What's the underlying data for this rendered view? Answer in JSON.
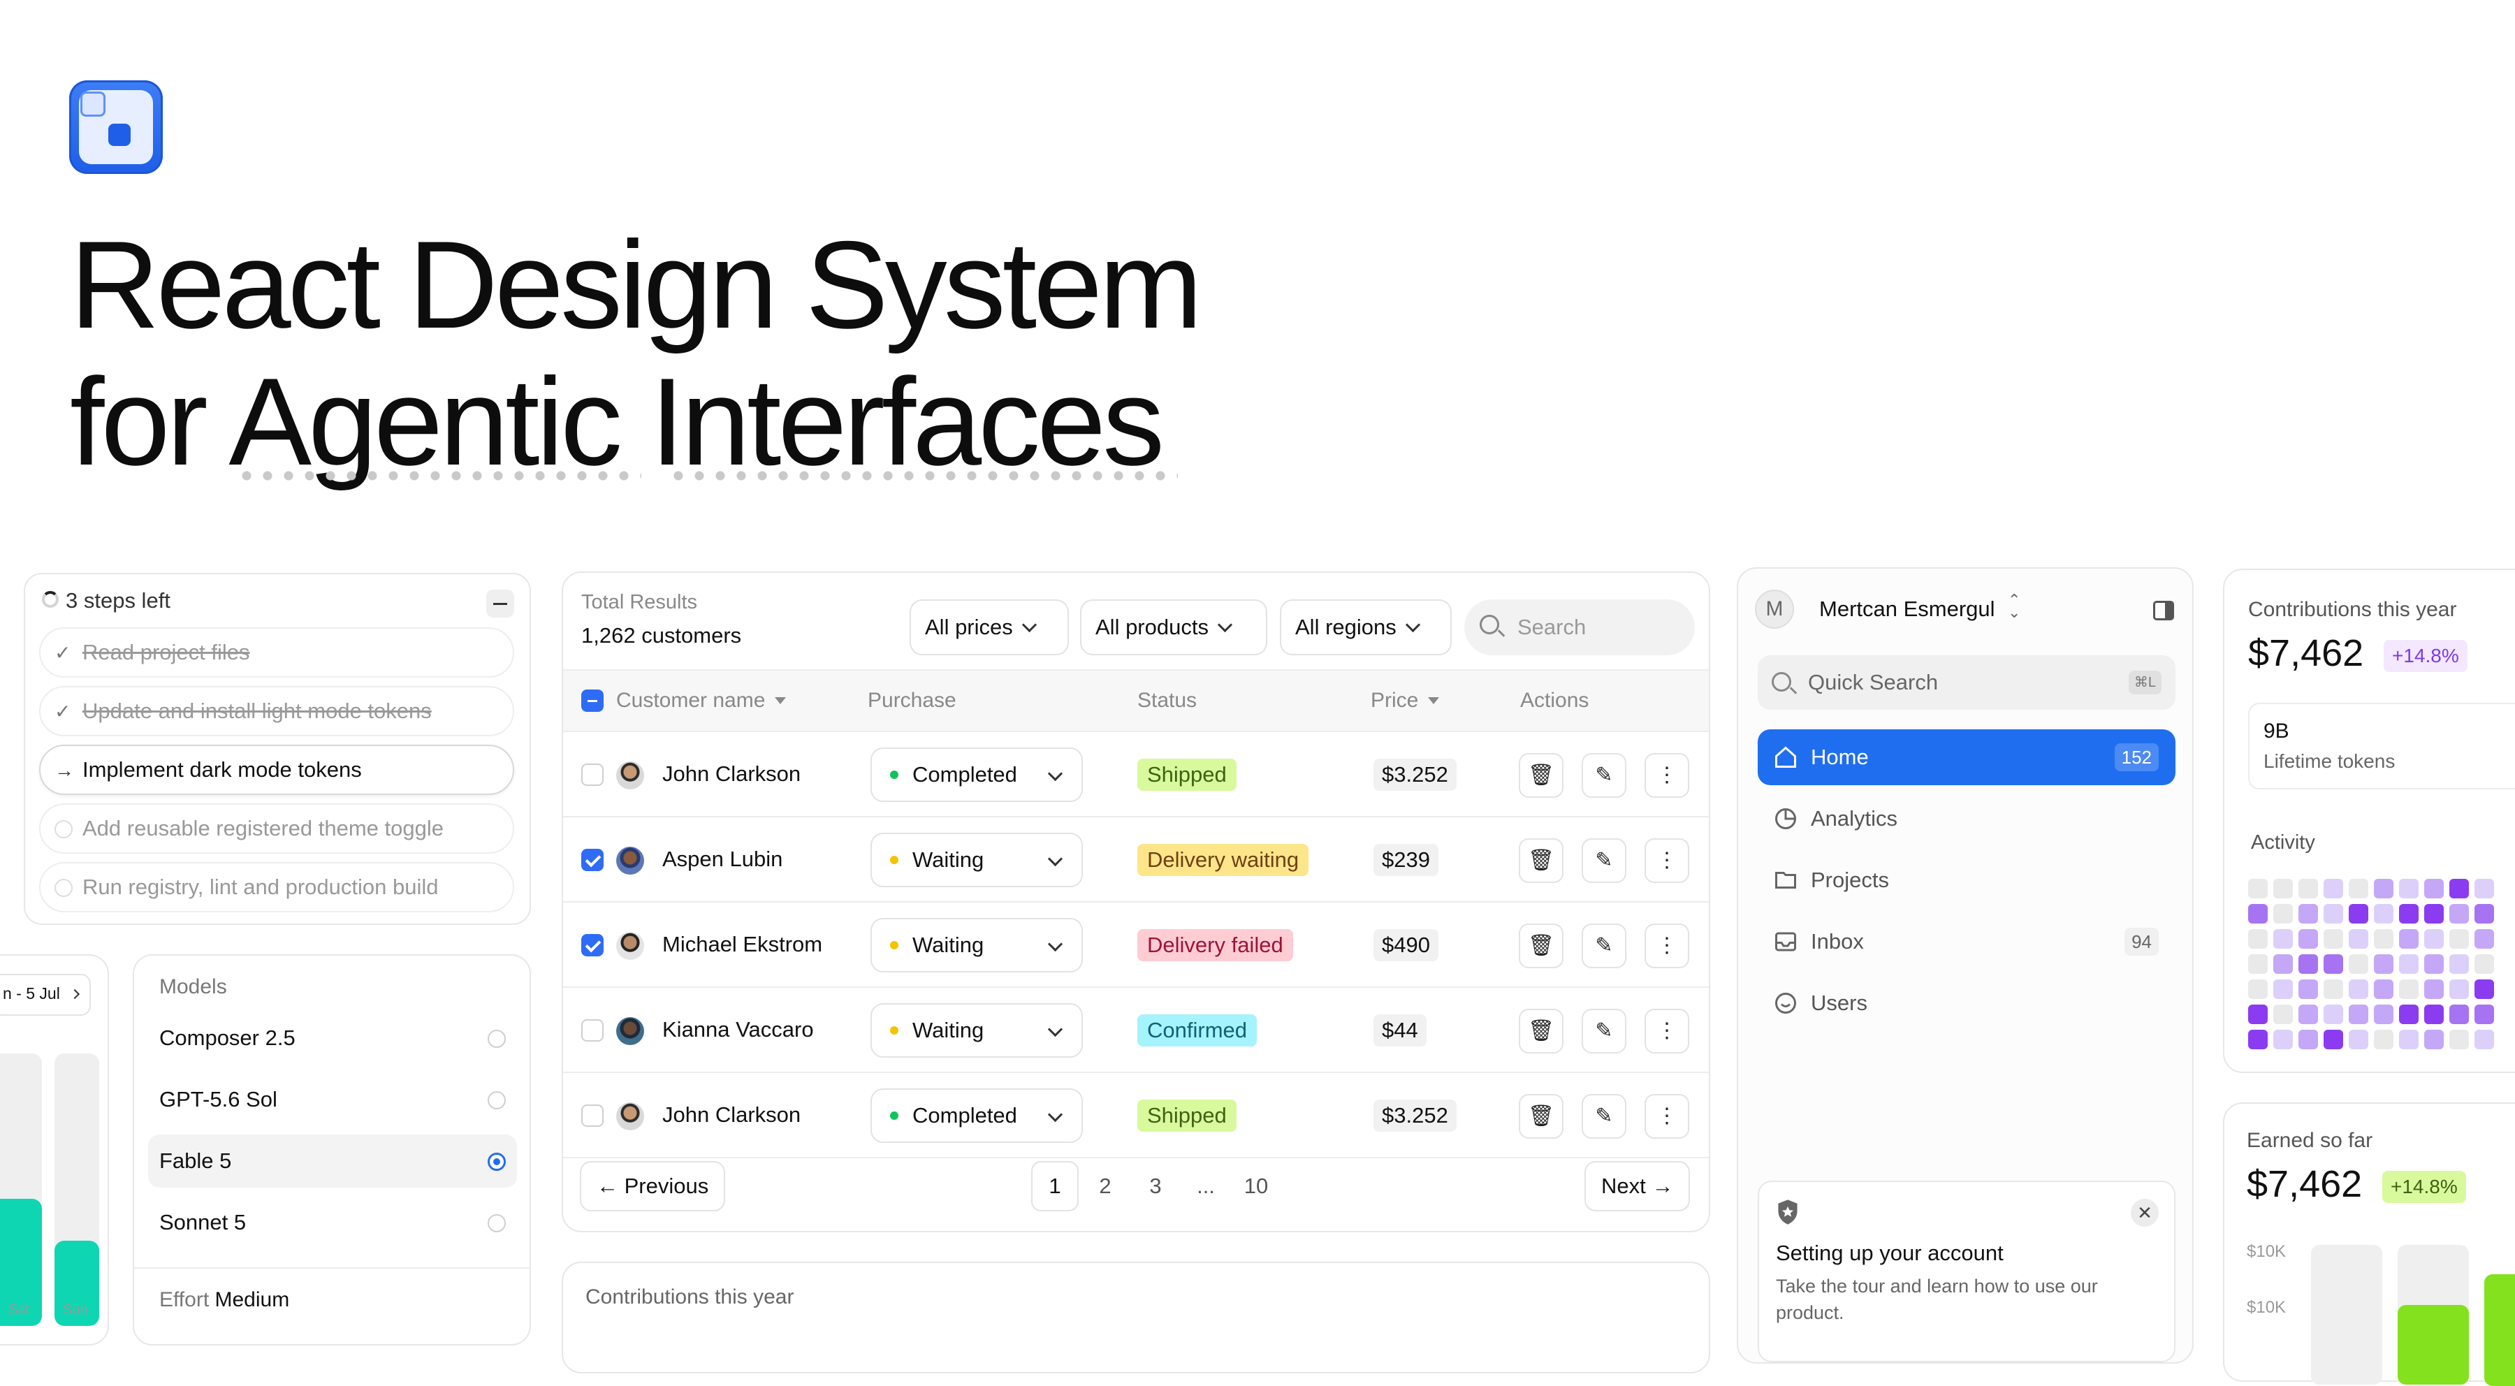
{
  "hero": {
    "title_line1": "React Design System",
    "title_line2": "for Agentic Interfaces"
  },
  "steps": {
    "header": "3 steps left",
    "items": [
      {
        "label": "Read project files",
        "state": "done"
      },
      {
        "label": "Update and install light mode tokens",
        "state": "done"
      },
      {
        "label": "Implement dark mode tokens",
        "state": "active"
      },
      {
        "label": "Add reusable registered theme toggle",
        "state": "todo"
      },
      {
        "label": "Run registry, lint and production build",
        "state": "todo"
      }
    ]
  },
  "mini_chart": {
    "range_label": "n - 5 Jul",
    "day_labels": [
      "Sat",
      "Sun"
    ]
  },
  "models": {
    "title": "Models",
    "items": [
      {
        "label": "Composer 2.5",
        "selected": false
      },
      {
        "label": "GPT-5.6 Sol",
        "selected": false
      },
      {
        "label": "Fable 5",
        "selected": true
      },
      {
        "label": "Sonnet 5",
        "selected": false
      }
    ],
    "effort_label": "Effort",
    "effort_value": "Medium"
  },
  "table": {
    "total_label": "Total Results",
    "total_value": "1,262 customers",
    "filters": [
      "All prices",
      "All products",
      "All regions"
    ],
    "search_placeholder": "Search",
    "columns": [
      "Customer name",
      "Purchase",
      "Status",
      "Price",
      "Actions"
    ],
    "rows": [
      {
        "name": "John Clarkson",
        "checked": false,
        "purchase": "Completed",
        "status": "Shipped",
        "price": "$3.252"
      },
      {
        "name": "Aspen Lubin",
        "checked": true,
        "purchase": "Waiting",
        "status": "Delivery waiting",
        "price": "$239"
      },
      {
        "name": "Michael Ekstrom",
        "checked": true,
        "purchase": "Waiting",
        "status": "Delivery failed",
        "price": "$490"
      },
      {
        "name": "Kianna Vaccaro",
        "checked": false,
        "purchase": "Waiting",
        "status": "Confirmed",
        "price": "$44"
      },
      {
        "name": "John Clarkson",
        "checked": false,
        "purchase": "Completed",
        "status": "Shipped",
        "price": "$3.252"
      }
    ],
    "pagination": {
      "previous": "Previous",
      "next": "Next",
      "pages": [
        "1",
        "2",
        "3",
        "...",
        "10"
      ],
      "current": "1"
    }
  },
  "contrib_bottom": {
    "title": "Contributions this year"
  },
  "sidebar": {
    "user_initial": "M",
    "user_name": "Mertcan Esmergul",
    "quick_search": "Quick Search",
    "shortcut": "⌘L",
    "items": [
      {
        "label": "Home",
        "count": "152",
        "active": true,
        "icon": "home-icon"
      },
      {
        "label": "Analytics",
        "count": "",
        "active": false,
        "icon": "pie-chart-icon"
      },
      {
        "label": "Projects",
        "count": "",
        "active": false,
        "icon": "folder-icon"
      },
      {
        "label": "Inbox",
        "count": "94",
        "active": false,
        "icon": "inbox-icon"
      },
      {
        "label": "Users",
        "count": "",
        "active": false,
        "icon": "smile-icon"
      }
    ],
    "notice_title": "Setting up your account",
    "notice_body": "Take the tour and learn how to use our product."
  },
  "contributions": {
    "title": "Contributions this year",
    "amount": "$7,462",
    "change": "+14.8%",
    "tokens_value": "9B",
    "tokens_label": "Lifetime tokens",
    "activity_label": "Activity"
  },
  "earned": {
    "title": "Earned so far",
    "amount": "$7,462",
    "change": "+14.8%",
    "ticks": [
      "$10K",
      "$10K"
    ]
  },
  "colors": {
    "accent": "#1f6ef0",
    "purple": "#7c3aed",
    "green_badge": "#d9f99d",
    "yellow_badge": "#fde68a",
    "red_badge": "#fecdd3",
    "cyan_badge": "#a5f3fc"
  }
}
